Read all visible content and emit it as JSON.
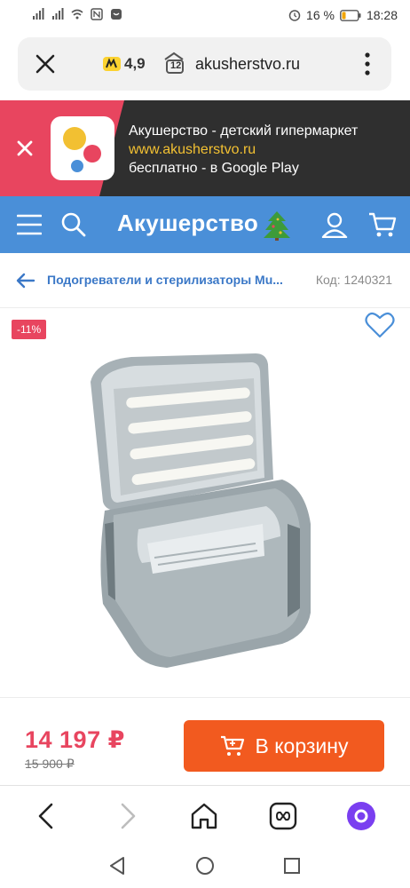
{
  "status_bar": {
    "battery_percent": "16 %",
    "time": "18:28",
    "icons": [
      "sim-icon",
      "signal-icon",
      "wifi-icon",
      "nfc-icon",
      "notification-icon",
      "alarm-icon",
      "battery-icon"
    ]
  },
  "url_bar": {
    "rating": "4,9",
    "tab_count": "12",
    "url": "akusherstvo.ru"
  },
  "app_banner": {
    "title": "Акушерство - детский гипермаркет",
    "link": "www.akusherstvo.ru",
    "subtitle": "бесплатно - в Google Play"
  },
  "header": {
    "brand": "Акушерство"
  },
  "breadcrumb": {
    "title": "Подогреватели и стерилизаторы Mu...",
    "code": "Код: 1240321"
  },
  "product": {
    "discount": "-11%"
  },
  "purchase": {
    "price": "14 197 ₽",
    "old_price": "15 900 ₽",
    "cart_button": "В корзину"
  },
  "colors": {
    "header_blue": "#4a8fd8",
    "accent_pink": "#e8455f",
    "cart_orange": "#f25a1f",
    "banner_dark": "#2f2f2f",
    "link_yellow": "#f2c032"
  }
}
